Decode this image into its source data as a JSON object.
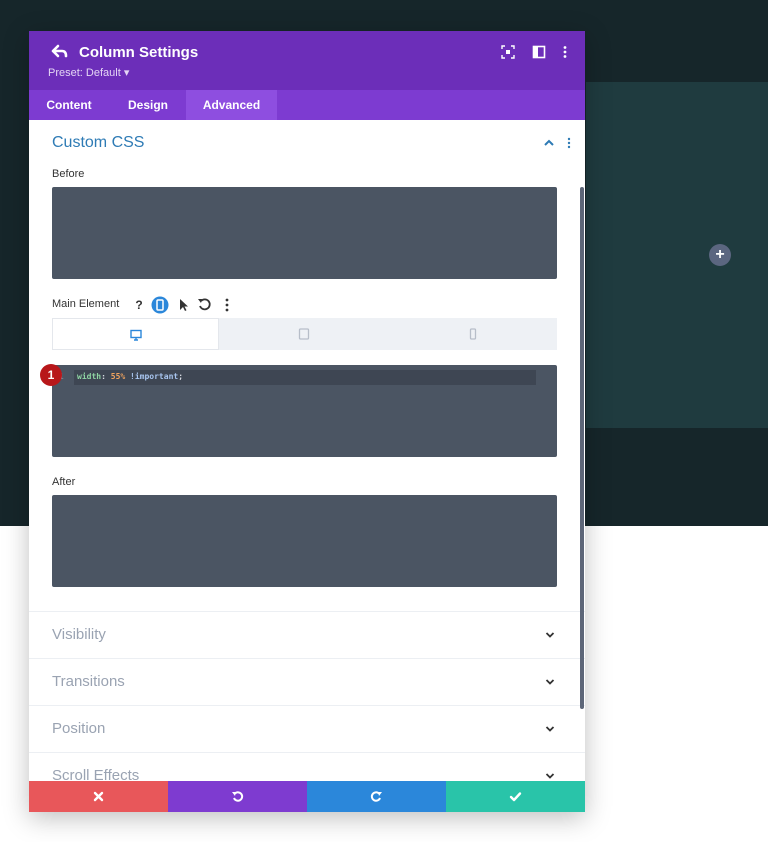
{
  "modal": {
    "title": "Column Settings",
    "preset": "Preset: Default ▾"
  },
  "tabs": [
    {
      "label": "Content"
    },
    {
      "label": "Design"
    },
    {
      "label": "Advanced"
    }
  ],
  "custom_css": {
    "title": "Custom CSS",
    "before_label": "Before",
    "main_element_label": "Main Element",
    "after_label": "After",
    "code": {
      "line_number": "1",
      "property": "width",
      "colon": ":",
      "value": "55%",
      "important": "!important",
      "semicolon": ";"
    },
    "marker": "1"
  },
  "accordions": [
    {
      "label": "Visibility"
    },
    {
      "label": "Transitions"
    },
    {
      "label": "Position"
    },
    {
      "label": "Scroll Effects"
    }
  ],
  "colors": {
    "header": "#6c2eb9",
    "tabs": "#7d3bd1",
    "cancel": "#e8575a",
    "reset": "#7e3bd0",
    "redo": "#2b87da",
    "save": "#29c4a9",
    "accent_blue": "#2e7bb5"
  },
  "icons": {
    "back": "back-arrow-icon",
    "focus": "focus-icon",
    "split": "split-view-icon",
    "more": "more-vertical-icon",
    "help": "help-icon",
    "mobile": "mobile-icon",
    "pointer": "pointer-icon",
    "undo": "undo-icon",
    "desktop": "desktop-icon",
    "tablet": "tablet-icon",
    "phone": "phone-icon",
    "add": "plus-icon"
  }
}
